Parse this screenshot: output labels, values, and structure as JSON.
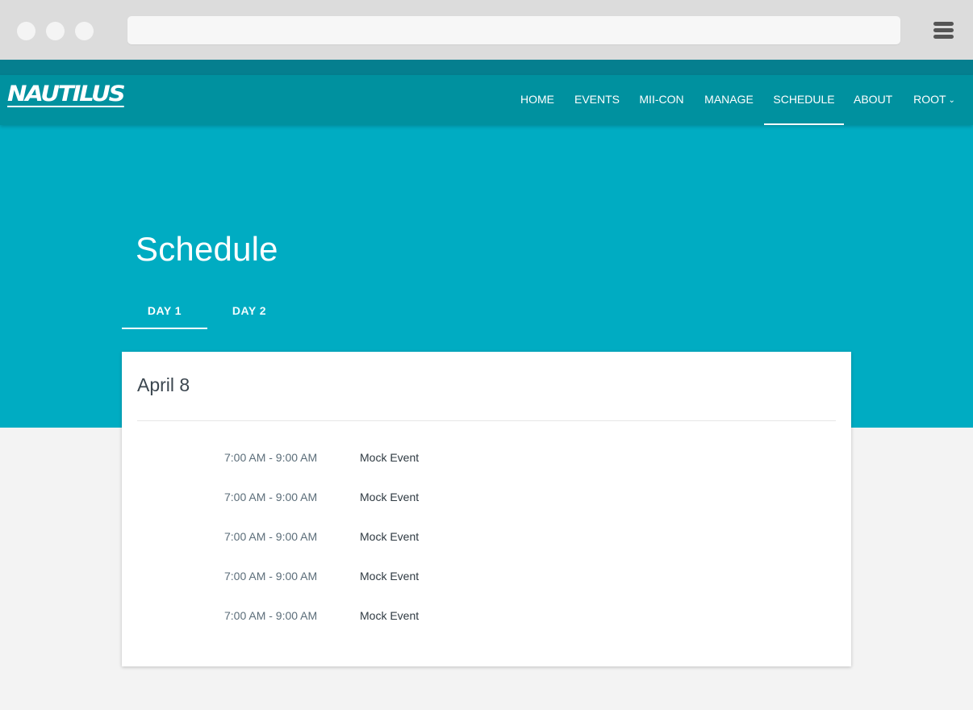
{
  "browser": {
    "address_value": ""
  },
  "nav": {
    "logo": "NAUTILUS",
    "items": [
      {
        "label": "HOME"
      },
      {
        "label": "EVENTS"
      },
      {
        "label": "MII-CON"
      },
      {
        "label": "MANAGE"
      },
      {
        "label": "SCHEDULE",
        "active": true
      },
      {
        "label": "ABOUT"
      },
      {
        "label": "ROOT",
        "has_dropdown": true
      }
    ]
  },
  "page": {
    "title": "Schedule",
    "tabs": [
      {
        "label": "DAY 1",
        "active": true
      },
      {
        "label": "DAY 2",
        "active": false
      }
    ]
  },
  "schedule": {
    "date": "April 8",
    "events": [
      {
        "time": "7:00 AM - 9:00 AM",
        "name": "Mock Event"
      },
      {
        "time": "7:00 AM - 9:00 AM",
        "name": "Mock Event"
      },
      {
        "time": "7:00 AM - 9:00 AM",
        "name": "Mock Event"
      },
      {
        "time": "7:00 AM - 9:00 AM",
        "name": "Mock Event"
      },
      {
        "time": "7:00 AM - 9:00 AM",
        "name": "Mock Event"
      }
    ]
  },
  "colors": {
    "nav_bg": "#00919f",
    "hero_bg": "#00acc2",
    "strip_bg": "#057f8f",
    "page_bg": "#f3f3f3"
  }
}
